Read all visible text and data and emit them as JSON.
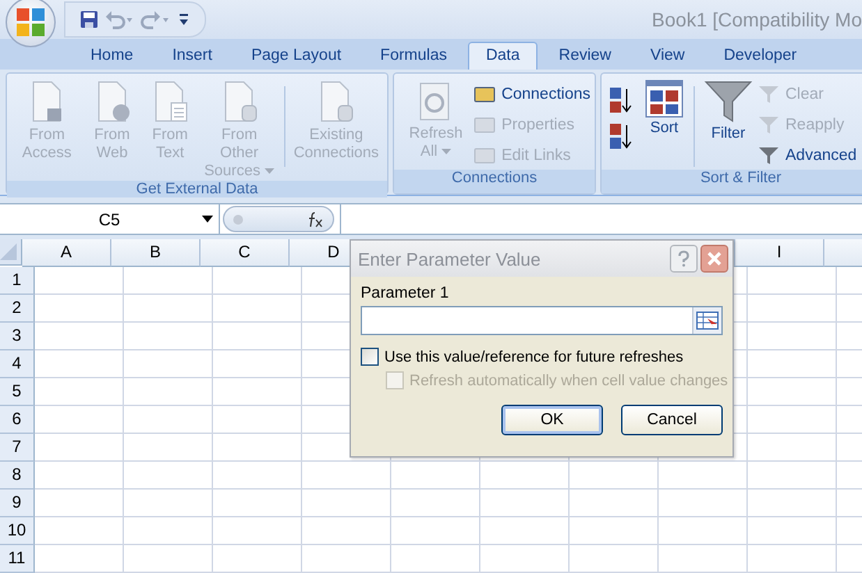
{
  "window": {
    "title": "Book1  [Compatibility Mo"
  },
  "tabs": [
    {
      "label": "Home",
      "selected": false
    },
    {
      "label": "Insert",
      "selected": false
    },
    {
      "label": "Page Layout",
      "selected": false
    },
    {
      "label": "Formulas",
      "selected": false
    },
    {
      "label": "Data",
      "selected": true
    },
    {
      "label": "Review",
      "selected": false
    },
    {
      "label": "View",
      "selected": false
    },
    {
      "label": "Developer",
      "selected": false
    }
  ],
  "ribbon": {
    "groups": [
      {
        "label": "Get External Data",
        "large": [
          {
            "label": "From Access",
            "disabled": true,
            "dropdown": false
          },
          {
            "label": "From Web",
            "disabled": true,
            "dropdown": false
          },
          {
            "label": "From Text",
            "disabled": true,
            "dropdown": false
          },
          {
            "label": "From Other Sources",
            "disabled": true,
            "dropdown": true
          },
          {
            "label": "Existing Connections",
            "disabled": true,
            "dropdown": false
          }
        ]
      },
      {
        "label": "Connections",
        "large": [
          {
            "label": "Refresh All",
            "disabled": true,
            "dropdown": true
          }
        ],
        "small": [
          {
            "label": "Connections",
            "disabled": false
          },
          {
            "label": "Properties",
            "disabled": true
          },
          {
            "label": "Edit Links",
            "disabled": true
          }
        ]
      },
      {
        "label": "Sort & Filter",
        "sort": {
          "label": "Sort",
          "disabled": false
        },
        "filter": {
          "label": "Filter",
          "disabled": false
        },
        "small": [
          {
            "label": "Clear",
            "disabled": true
          },
          {
            "label": "Reapply",
            "disabled": true
          },
          {
            "label": "Advanced",
            "disabled": false
          }
        ]
      }
    ]
  },
  "formula_bar": {
    "name_box": "C5"
  },
  "sheet": {
    "columns": [
      "A",
      "B",
      "C",
      "D",
      null,
      null,
      null,
      null,
      "I",
      null
    ],
    "rows": [
      "1",
      "2",
      "3",
      "4",
      "5",
      "6",
      "7",
      "8",
      "9",
      "10",
      "11"
    ]
  },
  "dialog": {
    "title": "Enter Parameter Value",
    "field_label": "Parameter 1",
    "checkboxes": [
      {
        "label": "Use this value/reference for future refreshes",
        "checked": false,
        "disabled": false
      },
      {
        "label": "Refresh automatically when cell value changes",
        "checked": false,
        "disabled": true
      }
    ],
    "buttons": [
      {
        "label": "OK",
        "default": true
      },
      {
        "label": "Cancel",
        "default": false
      }
    ]
  }
}
